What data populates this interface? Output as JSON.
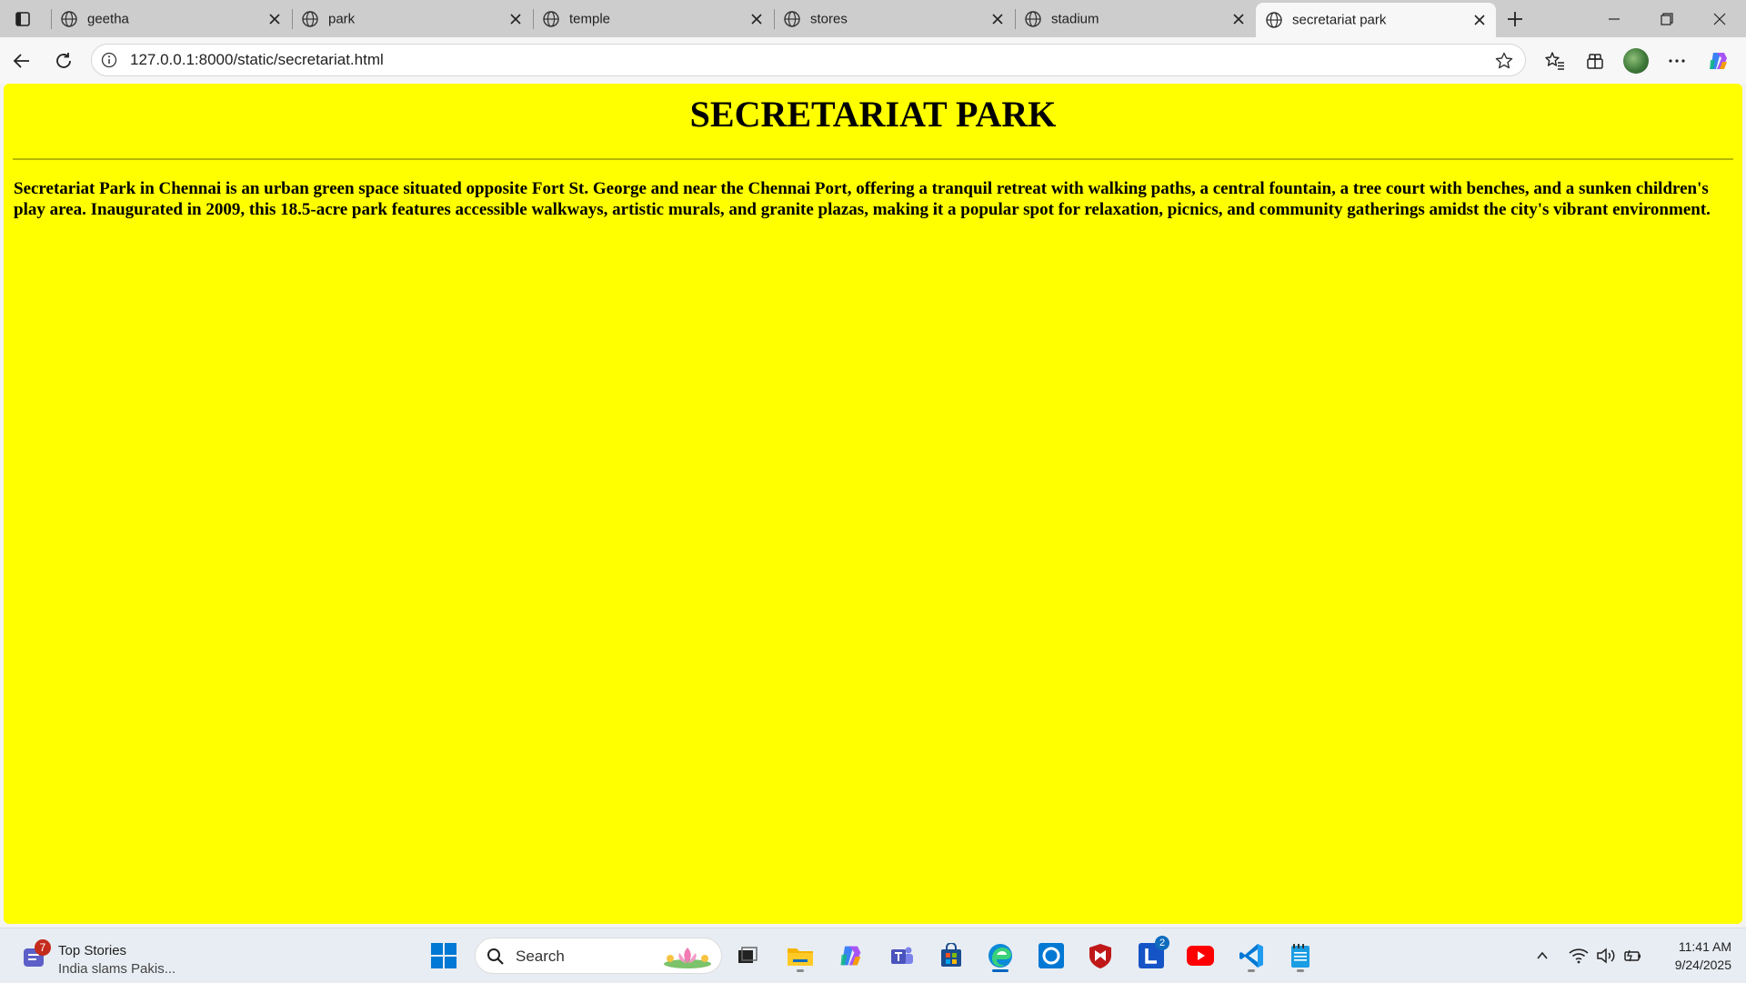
{
  "browser": {
    "tabs": [
      {
        "title": "geetha"
      },
      {
        "title": "park"
      },
      {
        "title": "temple"
      },
      {
        "title": "stores"
      },
      {
        "title": "stadium"
      },
      {
        "title": "secretariat park",
        "active": true
      }
    ],
    "url": "127.0.0.1:8000/static/secretariat.html"
  },
  "page": {
    "heading": "SECRETARIAT PARK",
    "paragraph": "Secretariat Park in Chennai is an urban green space situated opposite Fort St. George and near the Chennai Port, offering a tranquil retreat with walking paths, a central fountain, a tree court with benches, and a sunken children's play area. Inaugurated in 2009, this 18.5-acre park features accessible walkways, artistic murals, and granite plazas, making it a popular spot for relaxation, picnics, and community gatherings amidst the city's vibrant environment.",
    "background_color": "#ffff00"
  },
  "taskbar": {
    "news_title": "Top Stories",
    "news_subtitle": "India slams Pakis...",
    "news_badge": "7",
    "search_label": "Search",
    "l_app_badge": "2",
    "time": "11:41 AM",
    "date": "9/24/2025",
    "apps": [
      "task-view-icon",
      "file-explorer-icon",
      "copilot-icon",
      "teams-icon",
      "store-icon",
      "edge-icon",
      "cortana-icon",
      "mcafee-icon",
      "l-app-icon",
      "youtube-icon",
      "vscode-icon",
      "notepad-icon"
    ]
  }
}
